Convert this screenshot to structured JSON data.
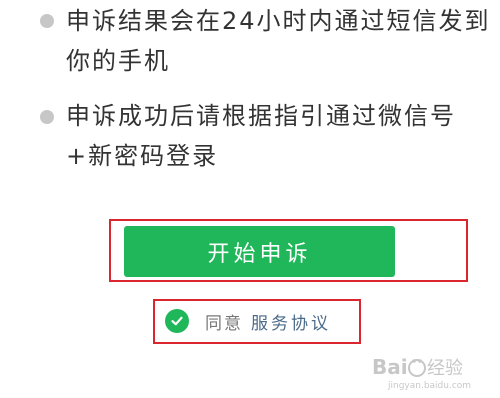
{
  "notes": {
    "items": [
      {
        "text": "申诉结果会在24小时内通过短信发到你的手机"
      },
      {
        "text": "申诉成功后请根据指引通过微信号+新密码登录"
      }
    ]
  },
  "actions": {
    "start_appeal_label": "开始申诉",
    "primary_color": "#1fb75a",
    "highlight_color": "#d9262f"
  },
  "agreement": {
    "agree_label": "同意",
    "terms_link": "服务协议",
    "checked": true
  },
  "watermark": {
    "text": "Baidu经验",
    "url_text": "jingyan.baidu.com"
  }
}
